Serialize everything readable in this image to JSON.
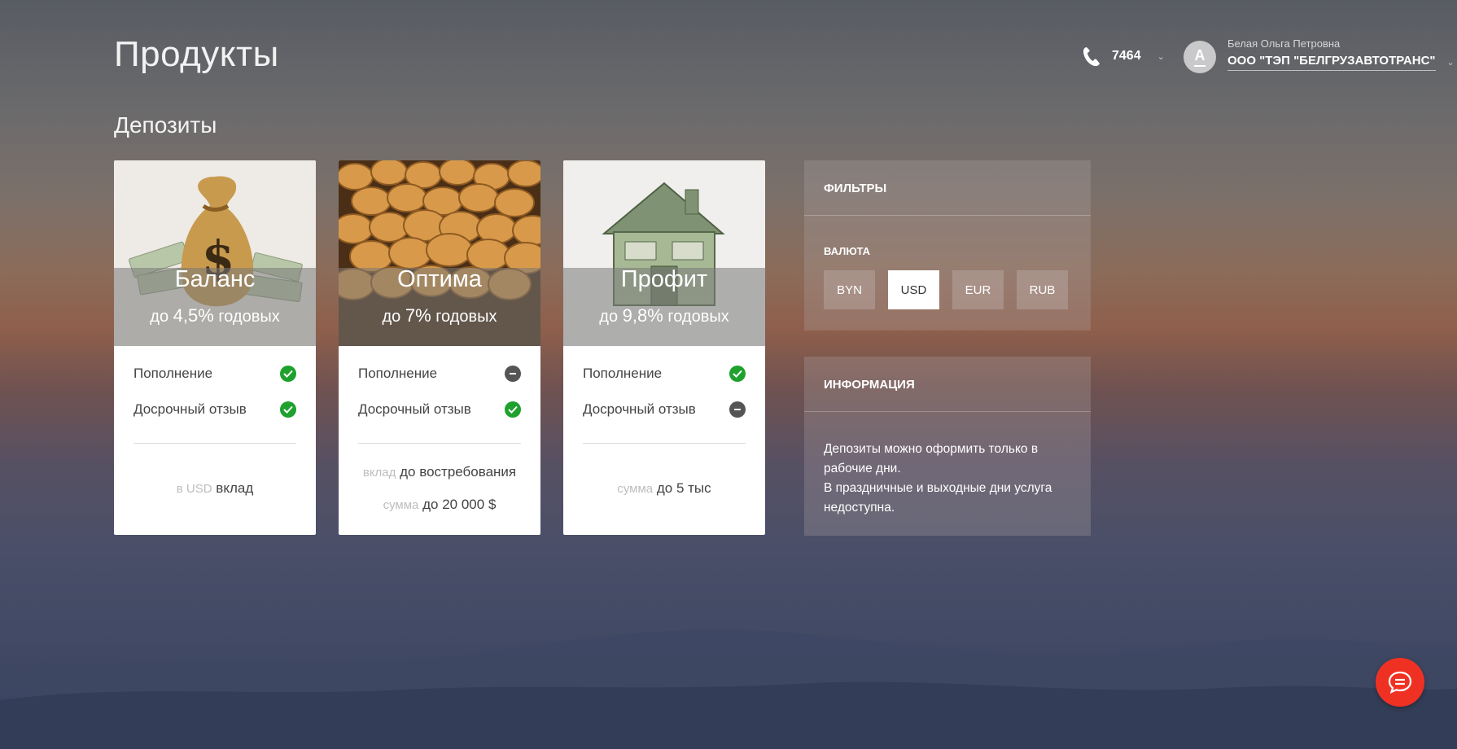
{
  "header": {
    "title": "Продукты",
    "phone": "7464",
    "user_name": "Белая Ольга Петровна",
    "user_org": "ООО \"ТЭП \"БЕЛГРУЗАВТОТРАНС\"",
    "avatar_letter": "А"
  },
  "section_title": "Депозиты",
  "cards": [
    {
      "name": "Баланс",
      "rate_prefix": "до",
      "rate_value": "4,5%",
      "rate_suffix": "годовых",
      "features": [
        {
          "label": "Пополнение",
          "available": true
        },
        {
          "label": "Досрочный отзыв",
          "available": true
        }
      ],
      "foot": [
        {
          "muted": "в USD",
          "text": "вклад"
        }
      ]
    },
    {
      "name": "Оптима",
      "rate_prefix": "до",
      "rate_value": "7%",
      "rate_suffix": "годовых",
      "features": [
        {
          "label": "Пополнение",
          "available": false
        },
        {
          "label": "Досрочный отзыв",
          "available": true
        }
      ],
      "foot": [
        {
          "muted": "вклад",
          "text": "до востребования"
        },
        {
          "muted": "сумма",
          "text": "до 20 000 $"
        }
      ]
    },
    {
      "name": "Профит",
      "rate_prefix": "до",
      "rate_value": "9,8%",
      "rate_suffix": "годовых",
      "features": [
        {
          "label": "Пополнение",
          "available": true
        },
        {
          "label": "Досрочный отзыв",
          "available": false
        }
      ],
      "foot": [
        {
          "muted": "сумма",
          "text": "до 5 тыс"
        }
      ]
    }
  ],
  "filters": {
    "title": "ФИЛЬТРЫ",
    "currency_label": "ВАЛЮТА",
    "currencies": [
      "BYN",
      "USD",
      "EUR",
      "RUB"
    ],
    "selected": "USD"
  },
  "info": {
    "title": "ИНФОРМАЦИЯ",
    "line1": "Депозиты можно оформить только в рабочие дни.",
    "line2": "В праздничные и выходные дни услуга недоступна."
  },
  "colors": {
    "accent_red": "#ef3124",
    "available_green": "#1fa12e",
    "unavailable_gray": "#555555"
  },
  "icons": {
    "phone": "phone-icon",
    "chat": "chat-icon",
    "check": "check-icon",
    "minus": "minus-icon"
  }
}
